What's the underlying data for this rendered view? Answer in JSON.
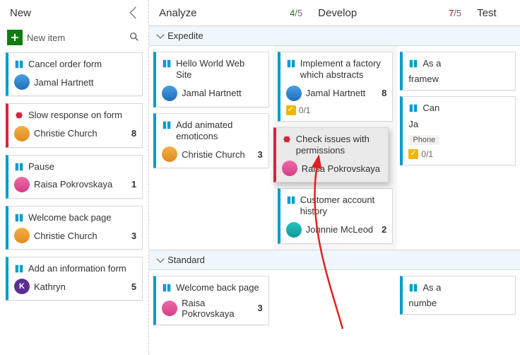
{
  "columns": {
    "new": {
      "title": "New",
      "new_item": "New item"
    },
    "analyze": {
      "title": "Analyze",
      "wip_num": "4",
      "wip_den": "/5"
    },
    "develop": {
      "title": "Develop",
      "wip_num": "7",
      "wip_den": "/5"
    },
    "test": {
      "title": "Test"
    }
  },
  "swimlanes": {
    "expedite": "Expedite",
    "standard": "Standard"
  },
  "new_cards": [
    {
      "type": "story",
      "title": "Cancel order form",
      "person": "Jamal Hartnett",
      "avatar": "jamal"
    },
    {
      "type": "bug",
      "title": "Slow response on form",
      "person": "Christie Church",
      "avatar": "christie",
      "count": "8"
    },
    {
      "type": "story",
      "title": "Pause",
      "person": "Raisa Pokrovskaya",
      "avatar": "raisa",
      "count": "1"
    },
    {
      "type": "story",
      "title": "Welcome back page",
      "person": "Christie Church",
      "avatar": "christie",
      "count": "3"
    },
    {
      "type": "story",
      "title": "Add an information form",
      "person": "Kathryn",
      "avatar": "kathryn",
      "count": "5"
    }
  ],
  "analyze_exp": [
    {
      "type": "story",
      "title": "Hello World Web Site",
      "person": "Jamal Hartnett",
      "avatar": "jamal"
    },
    {
      "type": "story",
      "title": "Add animated emoticons",
      "person": "Christie Church",
      "avatar": "christie",
      "count": "3"
    }
  ],
  "analyze_std": [
    {
      "type": "story",
      "title": "Welcome back page",
      "person": "Raisa Pokrovskaya",
      "avatar": "raisa",
      "count": "3"
    }
  ],
  "develop_exp": [
    {
      "type": "story",
      "title": "Implement a factory which abstracts",
      "person": "Jamal Hartnett",
      "avatar": "jamal",
      "count": "8",
      "tasks": "0/1"
    },
    {
      "type": "bug",
      "title": "Check issues with permissions",
      "person": "Raisa Pokrovskaya",
      "avatar": "raisa",
      "drag": true
    },
    {
      "type": "story",
      "title": "Customer account history",
      "person": "Johnnie McLeod",
      "avatar": "johnnie",
      "count": "2"
    }
  ],
  "test_exp": [
    {
      "type": "story",
      "title": "As a",
      "sub": "framew"
    },
    {
      "type": "story",
      "title": "Can",
      "sub": "Ja",
      "tag": "Phone",
      "tasks": "0/1"
    }
  ],
  "test_std": [
    {
      "type": "story",
      "title": "As a",
      "sub": "numbe"
    }
  ]
}
